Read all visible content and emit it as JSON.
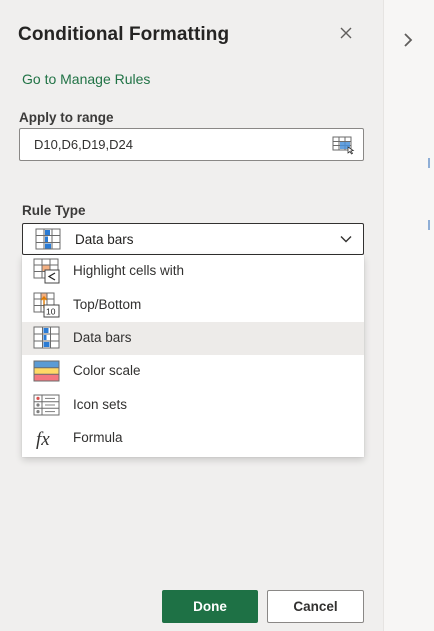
{
  "panel": {
    "title": "Conditional Formatting",
    "manage_rules_link": "Go to Manage Rules"
  },
  "apply_range": {
    "label": "Apply to range",
    "value": "D10,D6,D19,D24"
  },
  "rule_type": {
    "label": "Rule Type",
    "selected": "Data bars",
    "options": [
      {
        "label": "Highlight cells with",
        "icon": "highlight-cells-icon"
      },
      {
        "label": "Top/Bottom",
        "icon": "top-bottom-icon"
      },
      {
        "label": "Data bars",
        "icon": "data-bars-icon"
      },
      {
        "label": "Color scale",
        "icon": "color-scale-icon"
      },
      {
        "label": "Icon sets",
        "icon": "icon-sets-icon"
      },
      {
        "label": "Formula",
        "icon": "formula-icon"
      }
    ]
  },
  "footer": {
    "done_label": "Done",
    "cancel_label": "Cancel"
  },
  "colors": {
    "accent": "#1e7145",
    "link": "#217346"
  }
}
